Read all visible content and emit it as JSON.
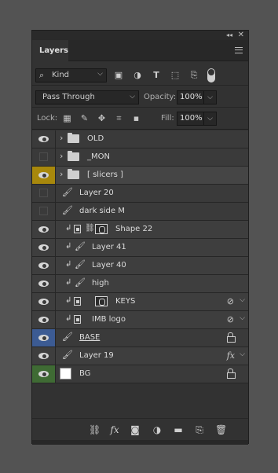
{
  "panel": {
    "tab_label": "Layers",
    "collapse_glyph": "◂◂",
    "close_glyph": "✕",
    "filter": {
      "kind_label": "Kind",
      "search_glyph": "⌕"
    },
    "blend": {
      "mode": "Pass Through",
      "opacity_label": "Opacity:",
      "opacity_value": "100%"
    },
    "lock": {
      "label": "Lock:",
      "fill_label": "Fill:",
      "fill_value": "100%"
    }
  },
  "layers": [
    {
      "name": "OLD"
    },
    {
      "name": "_MON"
    },
    {
      "name": "[ slicers ]"
    },
    {
      "name": "Layer 20"
    },
    {
      "name": "dark side M"
    },
    {
      "name": "Shape 22"
    },
    {
      "name": "Layer 41"
    },
    {
      "name": "Layer 40"
    },
    {
      "name": "high"
    },
    {
      "name": "KEYS"
    },
    {
      "name": "IMB logo"
    },
    {
      "name": "BASE"
    },
    {
      "name": "Layer 19"
    },
    {
      "name": "BG"
    }
  ],
  "colors": {
    "panel_bg": "#323232",
    "row_bg": "#3a3a3a",
    "row_alt": "#3e3e3e",
    "yellow_label": "#a8880c",
    "blue_label": "#3c5b93",
    "green_label": "#3f6b34"
  }
}
